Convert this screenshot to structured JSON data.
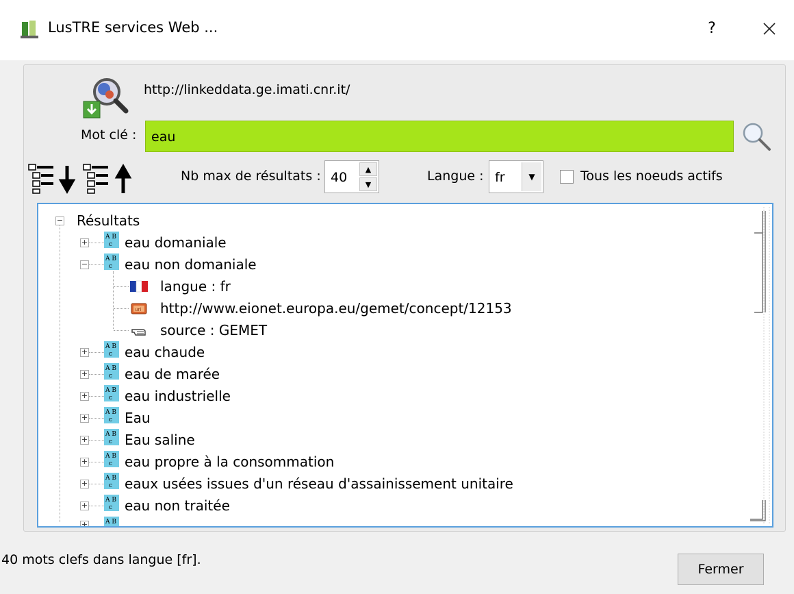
{
  "window": {
    "title": "LusTRE services Web ...",
    "help": "?"
  },
  "service": {
    "url": "http://linkeddata.ge.imati.cnr.it/"
  },
  "keyword": {
    "label": "Mot clé :",
    "value": "eau"
  },
  "options": {
    "max_results_label": "Nb max de résultats :",
    "max_results": "40",
    "language_label": "Langue :",
    "language": "fr",
    "all_nodes_label": "Tous les noeuds actifs",
    "all_nodes_checked": false
  },
  "tree": {
    "root": "Résultats",
    "expanded": {
      "label": "eau non domaniale",
      "children": [
        "langue : fr",
        "http://www.eionet.europa.eu/gemet/concept/12153",
        "source : GEMET"
      ]
    },
    "items": [
      "eau domaniale",
      "eau non domaniale",
      "eau chaude",
      "eau de marée",
      "eau industrielle",
      "Eau",
      "Eau saline",
      "eau propre à la consommation",
      "eaux usées issues d'un réseau d'assainissement unitaire",
      "eau non traitée"
    ]
  },
  "status": "40 mots clefs dans langue [fr].",
  "buttons": {
    "close": "Fermer"
  },
  "colors": {
    "keyword_bg": "#a6e41a",
    "tree_border": "#5aa0de"
  }
}
